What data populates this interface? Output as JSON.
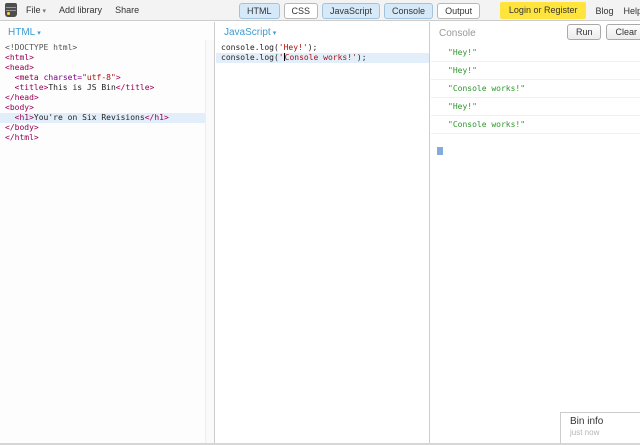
{
  "toolbar": {
    "file_label": "File",
    "add_library_label": "Add library",
    "share_label": "Share",
    "panel_buttons": [
      {
        "label": "HTML",
        "active": true
      },
      {
        "label": "CSS",
        "active": false
      },
      {
        "label": "JavaScript",
        "active": true
      },
      {
        "label": "Console",
        "active": true
      },
      {
        "label": "Output",
        "active": false
      }
    ],
    "login_label": "Login or Register",
    "blog_label": "Blog",
    "help_label": "Help"
  },
  "panels": {
    "html": {
      "title": "HTML",
      "active_line": 7,
      "code": [
        [
          {
            "c": "meta",
            "t": "<!DOCTYPE html>"
          }
        ],
        [
          {
            "c": "tag",
            "t": "<html>"
          }
        ],
        [
          {
            "c": "tag",
            "t": "<head>"
          }
        ],
        [
          {
            "c": "pln",
            "t": "  "
          },
          {
            "c": "tag",
            "t": "<meta"
          },
          {
            "c": "pln",
            "t": " "
          },
          {
            "c": "attr",
            "t": "charset="
          },
          {
            "c": "str",
            "t": "\"utf-8\""
          },
          {
            "c": "tag",
            "t": ">"
          }
        ],
        [
          {
            "c": "pln",
            "t": "  "
          },
          {
            "c": "tag",
            "t": "<title>"
          },
          {
            "c": "pln",
            "t": "This is JS Bin"
          },
          {
            "c": "tag",
            "t": "</title>"
          }
        ],
        [
          {
            "c": "tag",
            "t": "</head>"
          }
        ],
        [
          {
            "c": "tag",
            "t": "<body>"
          }
        ],
        [
          {
            "c": "pln",
            "t": "  "
          },
          {
            "c": "tag",
            "t": "<h1>"
          },
          {
            "c": "pln",
            "t": "You're on Six Revisions"
          },
          {
            "c": "tag",
            "t": "</h1>"
          }
        ],
        [
          {
            "c": "tag",
            "t": "</body>"
          }
        ],
        [
          {
            "c": "tag",
            "t": "</html>"
          }
        ]
      ]
    },
    "javascript": {
      "title": "JavaScript",
      "active_line": 1,
      "code": [
        [
          {
            "c": "pln",
            "t": "console.log("
          },
          {
            "c": "str",
            "t": "'Hey!'"
          },
          {
            "c": "pln",
            "t": ");"
          }
        ],
        [
          {
            "c": "pln",
            "t": "console.log("
          },
          {
            "c": "str",
            "t": "'"
          },
          {
            "c": "cur",
            "t": ""
          },
          {
            "c": "str",
            "t": "Console works!'"
          },
          {
            "c": "pln",
            "t": ");"
          }
        ]
      ]
    }
  },
  "console": {
    "title": "Console",
    "run_label": "Run",
    "clear_label": "Clear",
    "entries": [
      "\"Hey!\"",
      "\"Hey!\"",
      "\"Console works!\"",
      "\"Hey!\"",
      "\"Console works!\""
    ]
  },
  "bin_info": {
    "title": "Bin info",
    "timestamp": "just now"
  },
  "colors": {
    "tag": "#990055",
    "attribute": "#770088",
    "string": "#aa1111",
    "meta": "#555555",
    "text": "#222222",
    "console_entry": "#2d962d",
    "panel_label": "#3d9bd5",
    "active_line_bg": "#e2eefa",
    "login_bg": "#ffe43d"
  }
}
